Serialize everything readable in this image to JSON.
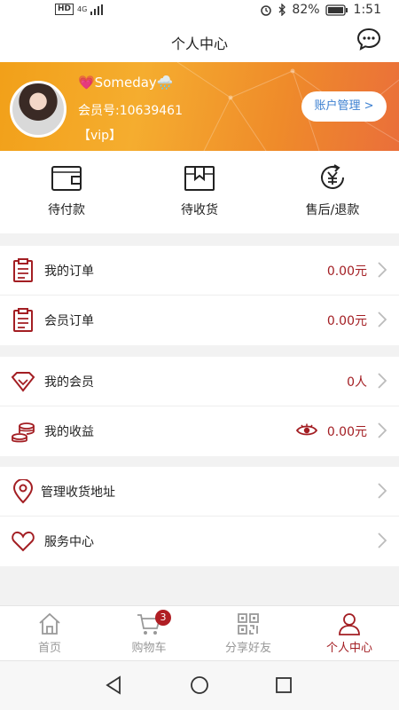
{
  "status": {
    "network": "4G",
    "hd": "HD",
    "battery": "82%",
    "time": "1:51"
  },
  "header": {
    "title": "个人中心"
  },
  "profile": {
    "nickname": "💗Someday🌧️",
    "member_no": "会员号:10639461",
    "level": "【vip】",
    "account_button": "账户管理 >"
  },
  "orders": [
    {
      "label": "待付款",
      "icon": "wallet-icon"
    },
    {
      "label": "待收货",
      "icon": "package-icon"
    },
    {
      "label": "售后/退款",
      "icon": "refund-yen-icon"
    }
  ],
  "list": {
    "my_orders": {
      "label": "我的订单",
      "value": "0.00元"
    },
    "member_orders": {
      "label": "会员订单",
      "value": "0.00元"
    },
    "my_members": {
      "label": "我的会员",
      "value": "0人"
    },
    "my_earnings": {
      "label": "我的收益",
      "value": "0.00元"
    },
    "address": {
      "label": "管理收货地址"
    },
    "service": {
      "label": "服务中心"
    }
  },
  "tabs": [
    {
      "label": "首页",
      "icon": "home-icon"
    },
    {
      "label": "购物车",
      "icon": "cart-icon",
      "badge": "3"
    },
    {
      "label": "分享好友",
      "icon": "qr-code-icon"
    },
    {
      "label": "个人中心",
      "icon": "user-icon"
    }
  ],
  "colors": {
    "accent": "#a31e23",
    "banner_start": "#f2a019",
    "banner_end": "#ea6f3a",
    "link": "#3b7fd0"
  }
}
